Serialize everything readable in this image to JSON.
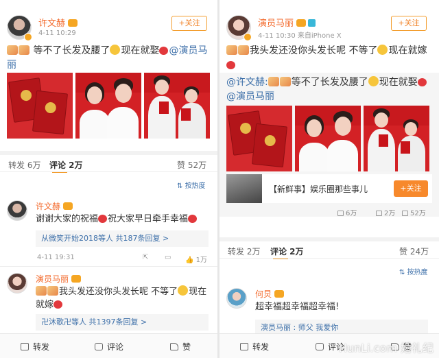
{
  "left": {
    "author": {
      "name": "许文赫",
      "meta": "4-11 10:29",
      "follow": "+关注"
    },
    "post": {
      "text_main": "等不了长发及腰了",
      "text_now": "现在就娶",
      "mention": "@演员马丽"
    },
    "stats": {
      "repost": "转发 6万",
      "comment": "评论 2万",
      "like": "赞 52万"
    },
    "sort": "按热度",
    "comments": [
      {
        "name": "许文赫",
        "text_a": "谢谢大家的祝福",
        "text_b": "祝大家早日牵手幸福",
        "reply_from": "从微笑开始2018等人",
        "reply_count": "共187条回复 >",
        "time": "4-11 19:31",
        "likes": "1万"
      },
      {
        "name": "演员马丽",
        "text_a": "我头发还没你头发长呢 不等了",
        "text_b": "现在就嫁",
        "reply_from": "卍沐歌卍等人",
        "reply_count": "共1397条回复 >"
      }
    ],
    "bottom": {
      "repost": "转发",
      "comment": "评论",
      "like": "赞"
    }
  },
  "right": {
    "author": {
      "name": "演员马丽",
      "meta": "4-11 10:30 来自iPhone X",
      "follow": "+关注"
    },
    "post": {
      "text_a": "我头发还没你头发长呢 不等了",
      "text_b": "现在就嫁"
    },
    "repost": {
      "mention_author": "@许文赫:",
      "text_main": "等不了长发及腰了",
      "text_now": "现在就娶",
      "mention": "@演员马丽"
    },
    "card": {
      "text": "【新鲜事】娱乐圈那些事儿",
      "follow": "+关注"
    },
    "mini_stats": {
      "repost": "6万",
      "comment": "2万",
      "like": "52万"
    },
    "stats": {
      "repost": "转发 2万",
      "comment": "评论 2万",
      "like": "赞 24万"
    },
    "sort": "按热度",
    "comments": [
      {
        "name": "何炅",
        "text": "超幸福超幸福超幸福!",
        "reply_partial": "演员马丽 : 师父 我爱你"
      }
    ],
    "bottom": {
      "repost": "转发",
      "comment": "评论",
      "like": "赞"
    },
    "watermark": "HunLi.com 婚礼纪"
  },
  "colors": {
    "accent": "#f39c2b",
    "username": "#f36a2c",
    "link": "#3b6ea8",
    "certificate_red": "#d52a2e"
  }
}
